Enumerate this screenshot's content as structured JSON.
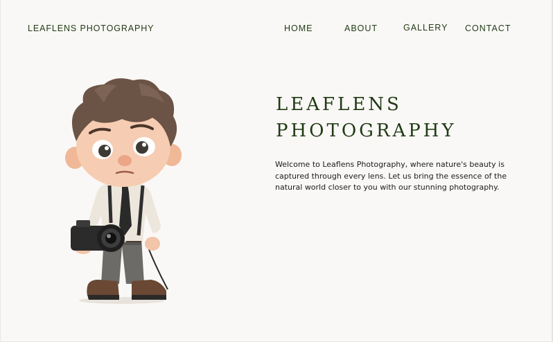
{
  "header": {
    "brand": "LEAFLENS PHOTOGRAPHY",
    "nav": {
      "home": "HOME",
      "about": "ABOUT",
      "gallery": "GALLERY",
      "contact": "CONTACT"
    }
  },
  "hero": {
    "title_line1": "LEAFLENS",
    "title_line2": "PHOTOGRAPHY",
    "description": "Welcome to Leaflens Photography, where nature's beauty is captured through every lens. Let us bring the essence of the natural world closer to you with our stunning photography."
  },
  "colors": {
    "background": "#faf8f6",
    "accent_green": "#1f3a14",
    "body_text": "#1b1b1b"
  },
  "icons": {
    "hero_image": "cartoon-photographer-illustration"
  }
}
